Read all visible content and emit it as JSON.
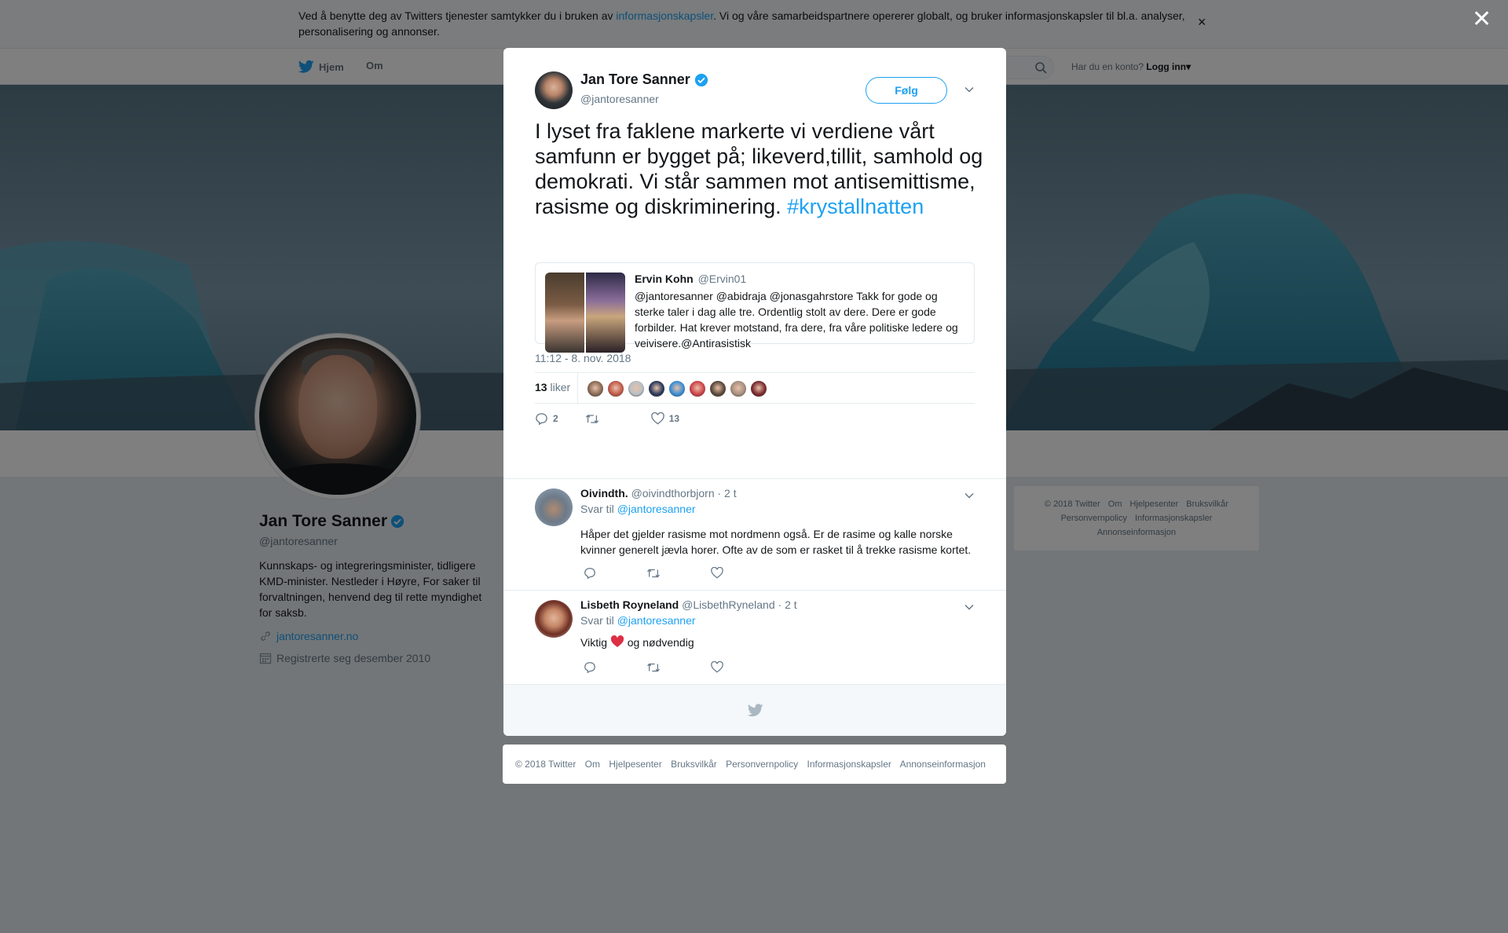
{
  "consent": {
    "text_before": "Ved å benytte deg av Twitters tjenester samtykker du i bruken av ",
    "link": "informasjonskapsler",
    "text_after": ". Vi og våre samarbeidspartnere opererer globalt, og bruker informasjonskapsler til bl.a. analyser, personalisering og annonser.",
    "close": "×"
  },
  "nav": {
    "home": "Hjem",
    "about": "Om",
    "account_prompt": "Har du en konto?",
    "login": "Logg inn"
  },
  "profile": {
    "name": "Jan Tore Sanner",
    "handle": "@jantoresanner",
    "bio": "Kunnskaps- og integreringsminister, tidligere KMD-minister. Nestleder i Høyre, For saker til forvaltningen, henvend deg til rette myndighet for saksb.",
    "website": "jantoresanner.no",
    "joined": "Registrerte seg desember 2010"
  },
  "side_footer": {
    "items": [
      "© 2018 Twitter",
      "Om",
      "Hjelpesenter",
      "Bruksvilkår",
      "Personvernpolicy",
      "Informasjonskapsler",
      "Annonseinformasjon"
    ]
  },
  "overlay": {
    "close": "✕"
  },
  "tweet": {
    "name": "Jan Tore Sanner",
    "handle": "@jantoresanner",
    "follow": "Følg",
    "text": "I lyset fra faklene markerte vi verdiene vårt samfunn er bygget på; likeverd,tillit, samhold og demokrati. Vi står sammen mot antisemittisme, rasisme og diskriminering.",
    "hashtag": "#krystallnatten",
    "quote": {
      "author": "Ervin Kohn",
      "handle": "@Ervin01",
      "text": "@jantoresanner @abidraja @jonasgahrstore Takk for gode og sterke taler i dag alle tre. Ordentlig stolt av dere. Dere er gode forbilder. Hat krever motstand, fra dere, fra våre politiske ledere og veivisere.@Antirasistisk"
    },
    "timestamp": "11:12 - 8. nov. 2018",
    "likes_count": "13",
    "likes_label": "liker",
    "replies": "2",
    "likes": "13",
    "liker_colors": [
      "#8a6b55",
      "#c25b4a",
      "#b9c0c6",
      "#2b3a5c",
      "#3b8fd6",
      "#d0444a",
      "#5b4a3c",
      "#a89080",
      "#7a2a30"
    ]
  },
  "replies": [
    {
      "name": "Oivindth.",
      "handle": "@oivindthorbjorn",
      "time": "· 2 t",
      "reply_prefix": "Svar til",
      "reply_to": "@jantoresanner",
      "text": "Håper det gjelder rasisme mot nordmenn også. Er de rasime og kalle norske kvinner generelt jævla horer. Ofte av de som er rasket til å trekke rasisme kortet."
    },
    {
      "name": "Lisbeth Royneland",
      "handle": "@LisbethRyneland",
      "time": "· 2 t",
      "reply_prefix": "Svar til",
      "reply_to": "@jantoresanner",
      "text_before": "Viktig ",
      "text_after": " og nødvendig"
    }
  ],
  "bottom_footer": {
    "items": [
      "© 2018 Twitter",
      "Om",
      "Hjelpesenter",
      "Bruksvilkår",
      "Personvernpolicy",
      "Informasjonskapsler",
      "Annonseinformasjon"
    ]
  },
  "colors": {
    "accent": "#1da1f2",
    "overlay": "rgba(0,0,0,0.5)",
    "heart": "#e0245e"
  }
}
